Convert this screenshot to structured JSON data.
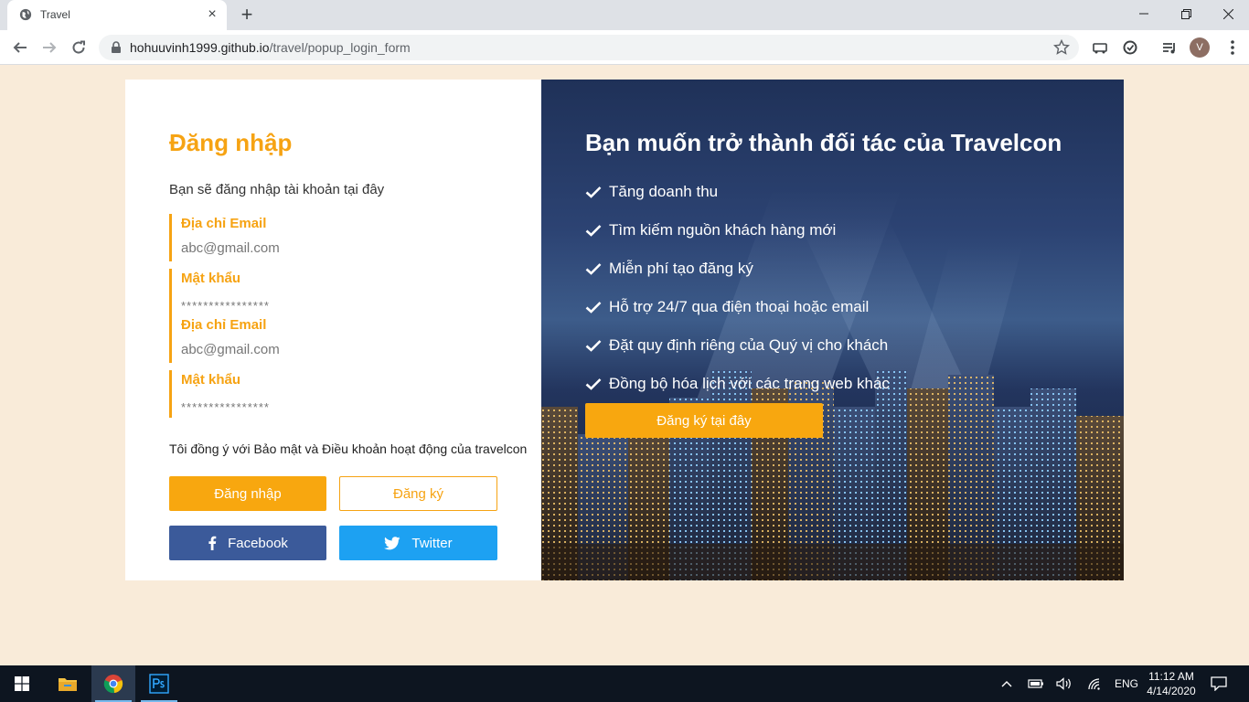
{
  "browser": {
    "tab_title": "Travel",
    "url_host": "hohuuvinh1999.github.io",
    "url_path": "/travel/popup_login_form",
    "profile_initial": "V"
  },
  "login": {
    "title": "Đăng nhập",
    "subtitle": "Bạn sẽ đăng nhập tài khoản tại đây",
    "fields": [
      {
        "label": "Địa chỉ Email",
        "value": "abc@gmail.com"
      },
      {
        "label": "Mật khẩu",
        "value": "****************"
      },
      {
        "label": "Địa chỉ Email",
        "value": "abc@gmail.com"
      },
      {
        "label": "Mật khẩu",
        "value": "****************"
      }
    ],
    "terms": "Tôi đồng ý với Bảo mật và Điều khoản hoạt động của travelcon",
    "login_button": "Đăng nhập",
    "register_button": "Đăng ký",
    "facebook_button": "Facebook",
    "twitter_button": "Twitter"
  },
  "partner": {
    "title": "Bạn muốn trở thành đối tác của Travelcon",
    "benefits": [
      "Tăng doanh thu",
      "Tìm kiếm nguồn khách hàng mới",
      "Miễn phí tạo đăng ký",
      "Hỗ trợ 24/7 qua điện thoại hoặc email",
      "Đặt quy định riêng của Quý vị cho khách",
      "Đồng bộ hóa lịch với các trang web khác"
    ],
    "register_button": "Đăng ký tại đây"
  },
  "taskbar": {
    "language": "ENG",
    "time": "11:12 AM",
    "date": "4/14/2020"
  },
  "colors": {
    "accent": "#f6a313",
    "facebook": "#3b5a9a",
    "twitter": "#1da1f2",
    "page_bg": "#f9ebd9"
  }
}
